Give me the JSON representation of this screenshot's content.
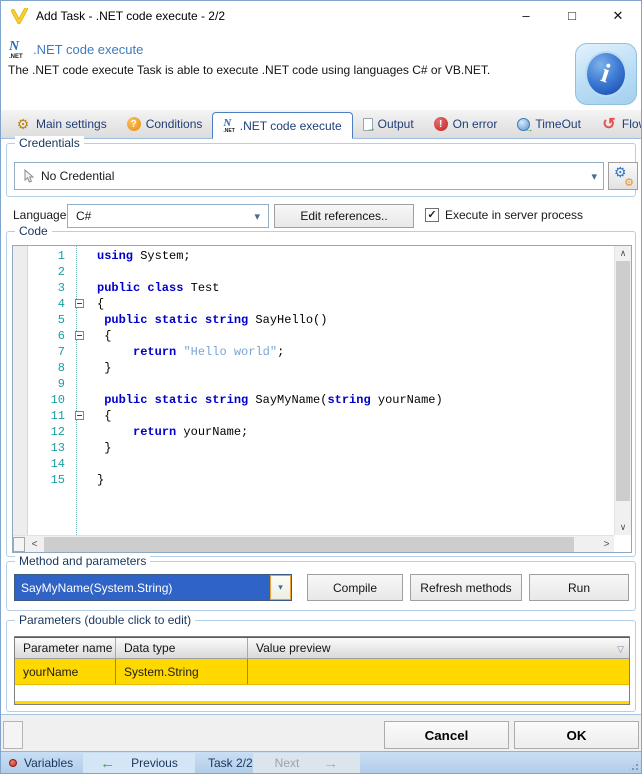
{
  "window": {
    "title": "Add Task - .NET code execute - 2/2",
    "controls": {
      "minimize": "–",
      "maximize": "□",
      "close": "✕"
    }
  },
  "header": {
    "task_name": ".NET code execute",
    "description": "The .NET code execute Task is able to execute .NET code using languages C# or VB.NET.",
    "net_icon_n": "N",
    "net_icon_net": ".NET",
    "info_glyph": "i"
  },
  "tabs": [
    {
      "label": "Main settings",
      "icon": "gears-icon",
      "active": false
    },
    {
      "label": "Conditions",
      "icon": "question-icon",
      "active": false
    },
    {
      "label": ".NET code execute",
      "icon": "dotnet-icon",
      "active": true
    },
    {
      "label": "Output",
      "icon": "output-icon",
      "active": false
    },
    {
      "label": "On error",
      "icon": "on-error-icon",
      "active": false
    },
    {
      "label": "TimeOut",
      "icon": "timeout-icon",
      "active": false
    },
    {
      "label": "Flow",
      "icon": "flow-icon",
      "active": false
    }
  ],
  "credentials": {
    "group_label": "Credentials",
    "selected": "No Credential"
  },
  "language": {
    "label": "Language:",
    "selected": "C#",
    "edit_references_label": "Edit references..",
    "server_process_label": "Execute in server process",
    "server_process_checked": true
  },
  "code": {
    "group_label": "Code",
    "lines": [
      {
        "n": 1,
        "fold": false,
        "segments": [
          {
            "t": "using",
            "c": "k"
          },
          {
            "t": " System;",
            "c": "p"
          }
        ]
      },
      {
        "n": 2,
        "fold": false,
        "segments": []
      },
      {
        "n": 3,
        "fold": false,
        "segments": [
          {
            "t": "public class",
            "c": "k"
          },
          {
            "t": " Test",
            "c": "p"
          }
        ]
      },
      {
        "n": 4,
        "fold": true,
        "segments": [
          {
            "t": "{",
            "c": "p"
          }
        ]
      },
      {
        "n": 5,
        "fold": false,
        "segments": [
          {
            "t": " ",
            "c": "p"
          },
          {
            "t": "public static string",
            "c": "k"
          },
          {
            "t": " SayHello()",
            "c": "p"
          }
        ]
      },
      {
        "n": 6,
        "fold": true,
        "segments": [
          {
            "t": " {",
            "c": "p"
          }
        ]
      },
      {
        "n": 7,
        "fold": false,
        "segments": [
          {
            "t": "     ",
            "c": "p"
          },
          {
            "t": "return",
            "c": "k"
          },
          {
            "t": " ",
            "c": "p"
          },
          {
            "t": "\"Hello world\"",
            "c": "s"
          },
          {
            "t": ";",
            "c": "p"
          }
        ]
      },
      {
        "n": 8,
        "fold": false,
        "segments": [
          {
            "t": " }",
            "c": "p"
          }
        ]
      },
      {
        "n": 9,
        "fold": false,
        "segments": []
      },
      {
        "n": 10,
        "fold": false,
        "segments": [
          {
            "t": " ",
            "c": "p"
          },
          {
            "t": "public static string",
            "c": "k"
          },
          {
            "t": " SayMyName(",
            "c": "p"
          },
          {
            "t": "string",
            "c": "k"
          },
          {
            "t": " yourName)",
            "c": "p"
          }
        ]
      },
      {
        "n": 11,
        "fold": true,
        "segments": [
          {
            "t": " {",
            "c": "p"
          }
        ]
      },
      {
        "n": 12,
        "fold": false,
        "segments": [
          {
            "t": "     ",
            "c": "p"
          },
          {
            "t": "return",
            "c": "k"
          },
          {
            "t": " yourName;",
            "c": "p"
          }
        ]
      },
      {
        "n": 13,
        "fold": false,
        "segments": [
          {
            "t": " }",
            "c": "p"
          }
        ]
      },
      {
        "n": 14,
        "fold": false,
        "segments": []
      },
      {
        "n": 15,
        "fold": false,
        "segments": [
          {
            "t": "}",
            "c": "p"
          }
        ]
      }
    ]
  },
  "method": {
    "group_label": "Method and parameters",
    "selected": "SayMyName(System.String)",
    "buttons": [
      "Compile",
      "Refresh methods",
      "Run"
    ]
  },
  "parameters": {
    "group_label": "Parameters (double click to edit)",
    "columns": [
      "Parameter name",
      "Data type",
      "Value preview"
    ],
    "rows": [
      {
        "name": "yourName",
        "type": "System.String",
        "value": ""
      }
    ]
  },
  "footer": {
    "cancel_label": "Cancel",
    "ok_label": "OK"
  },
  "statusbar": {
    "variables_label": "Variables",
    "previous_label": "Previous",
    "task_label": "Task 2/2",
    "next_label": "Next"
  },
  "icons": {
    "gear": "⚙",
    "question": "?",
    "exclamation": "!",
    "flow": "↺",
    "small_arrow": "→",
    "dropdown_arrow": "▾",
    "check": "✓",
    "scroll_up": "∧",
    "scroll_down": "∨",
    "scroll_left": "<",
    "scroll_right": ">",
    "filter": "▽",
    "arrow_left": "←",
    "arrow_right": "→"
  },
  "colors": {
    "accent_blue": "#3E7BBE",
    "tab_text": "#1F3E77",
    "keyword": "#0000C8",
    "string_literal": "#7AA5D6",
    "line_number": "#1B9E9E",
    "selected_combo_bg": "#2F63C6",
    "grid_row_gold": "#FFD800",
    "statusbar_bg": "#BDD7EE",
    "group_border": "#B5CFE7"
  }
}
